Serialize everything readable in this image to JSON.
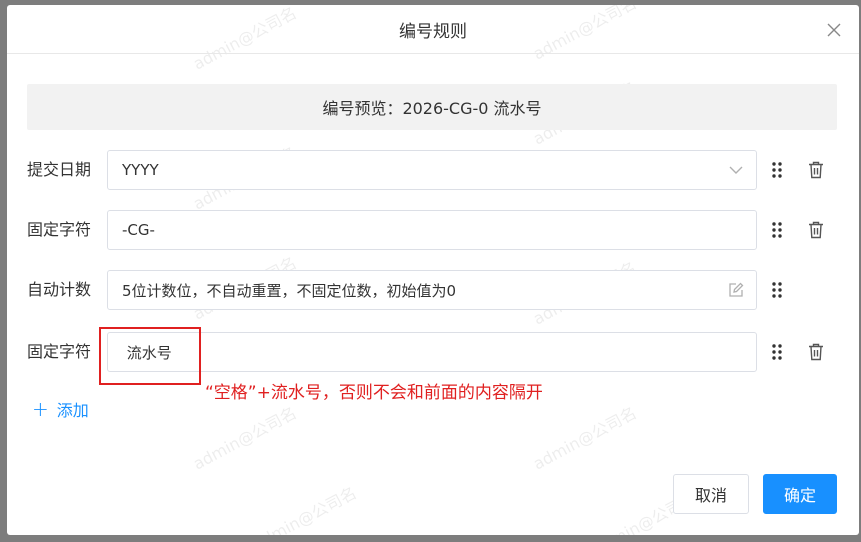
{
  "dialog": {
    "title": "编号规则",
    "close_icon": "close-icon"
  },
  "preview": {
    "text": "编号预览：2026-CG-0 流水号"
  },
  "rules": [
    {
      "label": "提交日期",
      "value": "YYYY",
      "type": "select",
      "suffix_icon": "chevron-down-icon",
      "deletable": true
    },
    {
      "label": "固定字符",
      "value": "-CG-",
      "type": "input",
      "deletable": true
    },
    {
      "label": "自动计数",
      "value": "5位计数位，不自动重置，不固定位数，初始值为0",
      "type": "readonly",
      "suffix_icon": "edit-icon",
      "deletable": false
    },
    {
      "label": "固定字符",
      "value": " 流水号",
      "type": "input",
      "deletable": true
    }
  ],
  "annotation": {
    "note": "“空格”+流水号，否则不会和前面的内容隔开",
    "color": "#e02020"
  },
  "add": {
    "label": "添加"
  },
  "footer": {
    "cancel_label": "取消",
    "ok_label": "确定"
  },
  "watermark": {
    "text": "admin@公司名"
  },
  "colors": {
    "primary": "#1890ff",
    "overlay": "#7d7d7d",
    "border": "#dcdfe6",
    "annotation": "#e02020"
  }
}
